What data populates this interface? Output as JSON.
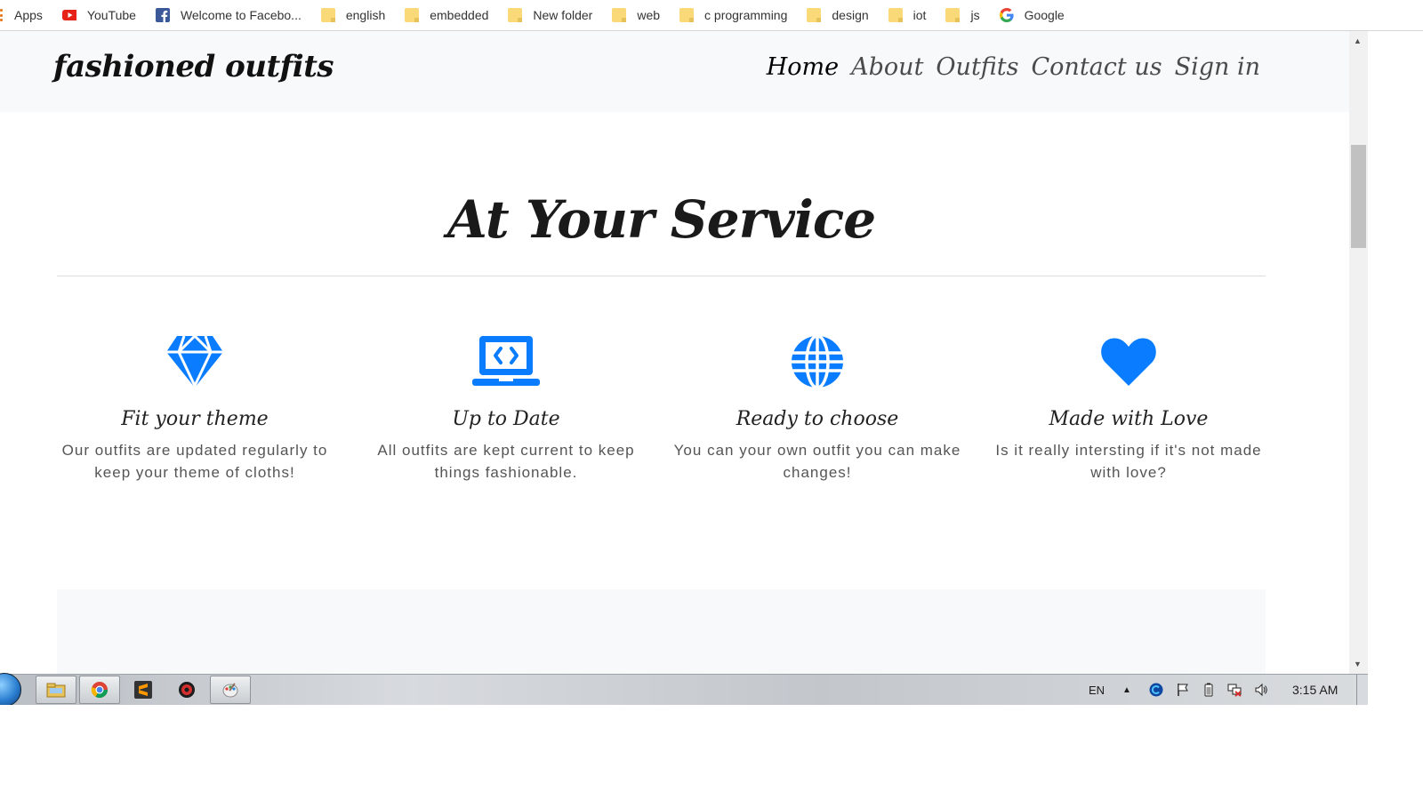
{
  "bookmarks": {
    "apps": "Apps",
    "items": [
      {
        "label": "YouTube",
        "icon": "youtube-icon"
      },
      {
        "label": "Welcome to Facebo...",
        "icon": "facebook-icon"
      },
      {
        "label": "english",
        "icon": "folder-icon"
      },
      {
        "label": "embedded",
        "icon": "folder-icon"
      },
      {
        "label": "New folder",
        "icon": "folder-icon"
      },
      {
        "label": "web",
        "icon": "folder-icon"
      },
      {
        "label": "c programming",
        "icon": "folder-icon"
      },
      {
        "label": "design",
        "icon": "folder-icon"
      },
      {
        "label": "iot",
        "icon": "folder-icon"
      },
      {
        "label": "js",
        "icon": "folder-icon"
      },
      {
        "label": "Google",
        "icon": "google-icon"
      }
    ]
  },
  "navbar": {
    "brand": "fashioned outfits",
    "links": [
      {
        "label": "Home",
        "active": true
      },
      {
        "label": "About",
        "active": false
      },
      {
        "label": "Outfits",
        "active": false
      },
      {
        "label": "Contact us",
        "active": false
      },
      {
        "label": "Sign in",
        "active": false
      }
    ]
  },
  "service": {
    "title": "At Your Service",
    "features": [
      {
        "icon": "gem-icon",
        "title": "Fit your theme",
        "text": "Our outfits are updated regularly to keep your theme of cloths!"
      },
      {
        "icon": "laptop-code-icon",
        "title": "Up to Date",
        "text": "All outfits are kept current to keep things fashionable."
      },
      {
        "icon": "globe-icon",
        "title": "Ready to choose",
        "text": "You can your own outfit you can make changes!"
      },
      {
        "icon": "heart-icon",
        "title": "Made with Love",
        "text": "Is it really intersting if it's not made with love?"
      }
    ]
  },
  "colors": {
    "accent": "#0a7cff",
    "navbar_bg": "#f8f9fa"
  },
  "taskbar": {
    "language": "EN",
    "time": "3:15 AM",
    "apps": [
      "explorer-icon",
      "chrome-icon",
      "sublime-icon",
      "game-icon",
      "paint-icon"
    ]
  }
}
